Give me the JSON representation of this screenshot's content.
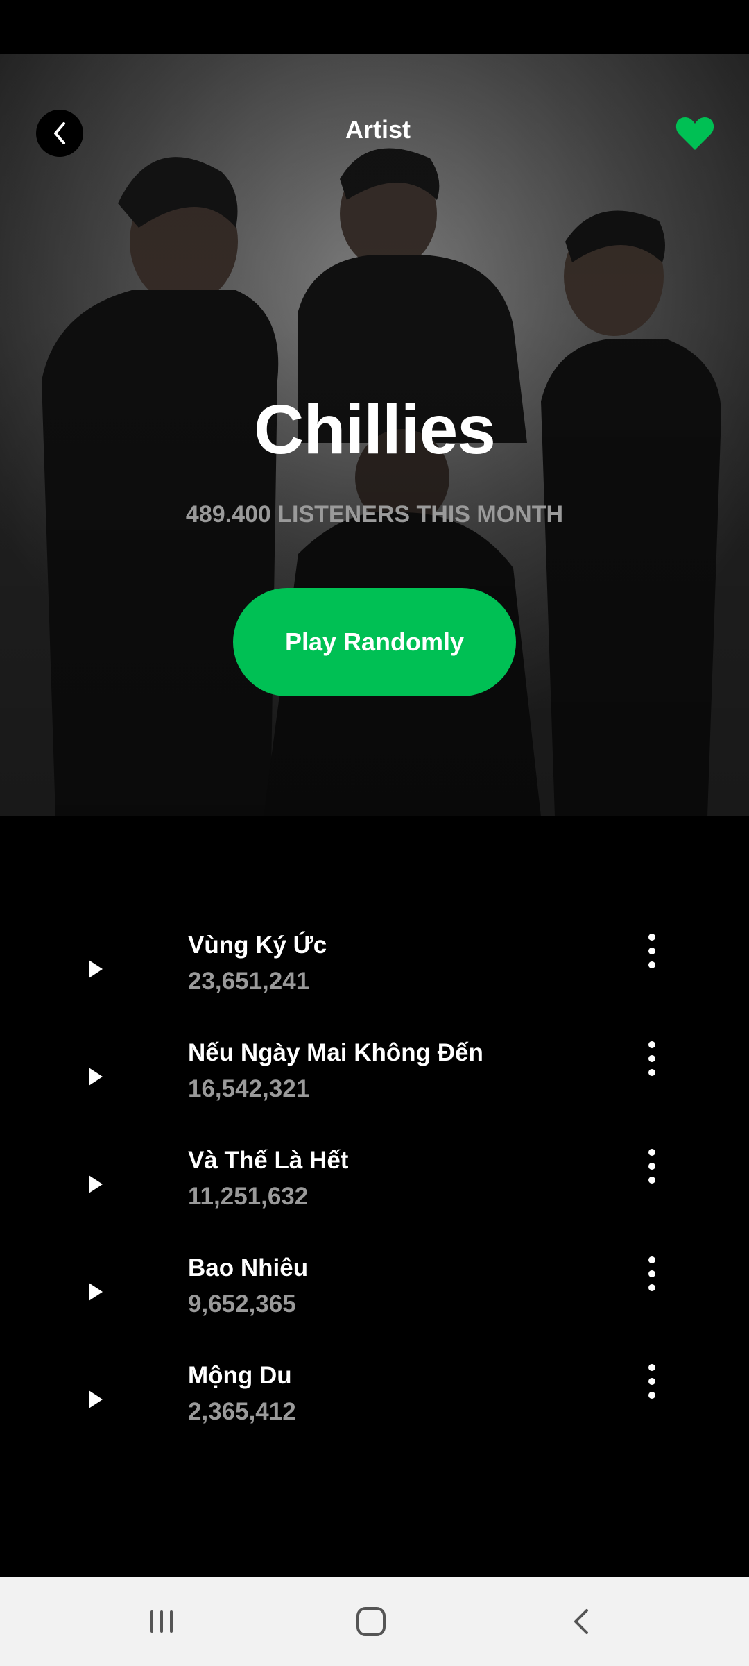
{
  "header": {
    "title": "Artist",
    "back_icon": "chevron-left-icon",
    "favorite_icon": "heart-icon",
    "favorite_color": "#00c054"
  },
  "artist": {
    "name": "Chillies",
    "listeners": "489.400 LISTENERS THIS MONTH"
  },
  "actions": {
    "play_randomly_label": "Play Randomly",
    "accent_color": "#00c054"
  },
  "tracks": [
    {
      "title": "Vùng Ký Ức",
      "plays": "23,651,241"
    },
    {
      "title": "Nếu Ngày Mai Không Đến",
      "plays": "16,542,321"
    },
    {
      "title": "Và Thế Là Hết",
      "plays": "11,251,632"
    },
    {
      "title": "Bao Nhiêu",
      "plays": "9,652,365"
    },
    {
      "title": "Mộng Du",
      "plays": "2,365,412"
    }
  ],
  "system_nav": {
    "recents_icon": "recents-icon",
    "home_icon": "home-icon",
    "back_icon": "back-icon"
  }
}
